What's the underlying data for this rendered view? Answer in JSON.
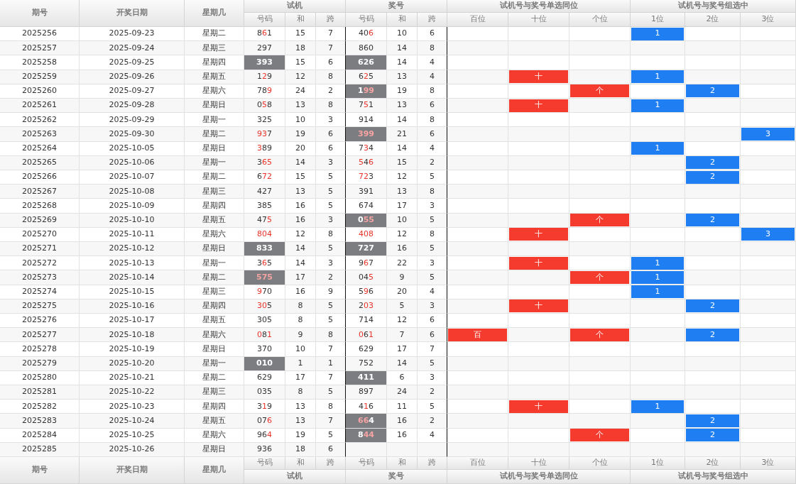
{
  "header": {
    "columns": [
      "期号",
      "开奖日期",
      "星期几"
    ],
    "groups": [
      {
        "label": "试机",
        "sub": [
          "号码",
          "和",
          "跨"
        ]
      },
      {
        "label": "奖号",
        "sub": [
          "号码",
          "和",
          "跨"
        ]
      },
      {
        "label": "试机号与奖号单选同位",
        "sub": [
          "百位",
          "十位",
          "个位"
        ]
      },
      {
        "label": "试机号与奖号组选中",
        "sub": [
          "1位",
          "2位",
          "3位"
        ]
      }
    ]
  },
  "rows": [
    {
      "issue": "2025256",
      "date": "2025-09-23",
      "weekday": "星期二",
      "trial": {
        "number": "861",
        "hits": [
          false,
          true,
          false
        ],
        "shaded": false
      },
      "trial_sum": "15",
      "trial_span": "7",
      "draw": {
        "number": "406",
        "hits": [
          false,
          false,
          true
        ],
        "shaded": false
      },
      "draw_sum": "10",
      "draw_span": "6",
      "single": {},
      "group": {
        "p1": "1"
      }
    },
    {
      "issue": "2025257",
      "date": "2025-09-24",
      "weekday": "星期三",
      "trial": {
        "number": "297",
        "hits": [
          false,
          false,
          false
        ],
        "shaded": false
      },
      "trial_sum": "18",
      "trial_span": "7",
      "draw": {
        "number": "860",
        "hits": [
          false,
          false,
          false
        ],
        "shaded": false
      },
      "draw_sum": "14",
      "draw_span": "8",
      "single": {},
      "group": {}
    },
    {
      "issue": "2025258",
      "date": "2025-09-25",
      "weekday": "星期四",
      "trial": {
        "number": "393",
        "hits": [
          false,
          false,
          false
        ],
        "shaded": true
      },
      "trial_sum": "15",
      "trial_span": "6",
      "draw": {
        "number": "626",
        "hits": [
          false,
          false,
          false
        ],
        "shaded": true
      },
      "draw_sum": "14",
      "draw_span": "4",
      "single": {},
      "group": {}
    },
    {
      "issue": "2025259",
      "date": "2025-09-26",
      "weekday": "星期五",
      "trial": {
        "number": "129",
        "hits": [
          false,
          true,
          false
        ],
        "shaded": false
      },
      "trial_sum": "12",
      "trial_span": "8",
      "draw": {
        "number": "625",
        "hits": [
          false,
          true,
          false
        ],
        "shaded": false
      },
      "draw_sum": "13",
      "draw_span": "4",
      "single": {
        "shi": "十"
      },
      "group": {
        "p1": "1"
      }
    },
    {
      "issue": "2025260",
      "date": "2025-09-27",
      "weekday": "星期六",
      "trial": {
        "number": "789",
        "hits": [
          false,
          false,
          true
        ],
        "shaded": false
      },
      "trial_sum": "24",
      "trial_span": "2",
      "draw": {
        "number": "199",
        "hits": [
          false,
          true,
          true
        ],
        "shaded": true
      },
      "draw_sum": "19",
      "draw_span": "8",
      "single": {
        "ge": "个"
      },
      "group": {
        "p2": "2"
      }
    },
    {
      "issue": "2025261",
      "date": "2025-09-28",
      "weekday": "星期日",
      "trial": {
        "number": "058",
        "hits": [
          false,
          true,
          false
        ],
        "shaded": false
      },
      "trial_sum": "13",
      "trial_span": "8",
      "draw": {
        "number": "751",
        "hits": [
          false,
          true,
          false
        ],
        "shaded": false
      },
      "draw_sum": "13",
      "draw_span": "6",
      "single": {
        "shi": "十"
      },
      "group": {
        "p1": "1"
      }
    },
    {
      "issue": "2025262",
      "date": "2025-09-29",
      "weekday": "星期一",
      "trial": {
        "number": "325",
        "hits": [
          false,
          false,
          false
        ],
        "shaded": false
      },
      "trial_sum": "10",
      "trial_span": "3",
      "draw": {
        "number": "914",
        "hits": [
          false,
          false,
          false
        ],
        "shaded": false
      },
      "draw_sum": "14",
      "draw_span": "8",
      "single": {},
      "group": {}
    },
    {
      "issue": "2025263",
      "date": "2025-09-30",
      "weekday": "星期二",
      "trial": {
        "number": "937",
        "hits": [
          true,
          true,
          false
        ],
        "shaded": false
      },
      "trial_sum": "19",
      "trial_span": "6",
      "draw": {
        "number": "399",
        "hits": [
          true,
          true,
          true
        ],
        "shaded": true
      },
      "draw_sum": "21",
      "draw_span": "6",
      "single": {},
      "group": {
        "p3": "3"
      }
    },
    {
      "issue": "2025264",
      "date": "2025-10-05",
      "weekday": "星期日",
      "trial": {
        "number": "389",
        "hits": [
          true,
          false,
          false
        ],
        "shaded": false
      },
      "trial_sum": "20",
      "trial_span": "6",
      "draw": {
        "number": "734",
        "hits": [
          false,
          true,
          false
        ],
        "shaded": false
      },
      "draw_sum": "14",
      "draw_span": "4",
      "single": {},
      "group": {
        "p1": "1"
      }
    },
    {
      "issue": "2025265",
      "date": "2025-10-06",
      "weekday": "星期一",
      "trial": {
        "number": "365",
        "hits": [
          false,
          true,
          true
        ],
        "shaded": false
      },
      "trial_sum": "14",
      "trial_span": "3",
      "draw": {
        "number": "546",
        "hits": [
          true,
          false,
          true
        ],
        "shaded": false
      },
      "draw_sum": "15",
      "draw_span": "2",
      "single": {},
      "group": {
        "p2": "2"
      }
    },
    {
      "issue": "2025266",
      "date": "2025-10-07",
      "weekday": "星期二",
      "trial": {
        "number": "672",
        "hits": [
          false,
          true,
          true
        ],
        "shaded": false
      },
      "trial_sum": "15",
      "trial_span": "5",
      "draw": {
        "number": "723",
        "hits": [
          true,
          true,
          false
        ],
        "shaded": false
      },
      "draw_sum": "12",
      "draw_span": "5",
      "single": {},
      "group": {
        "p2": "2"
      }
    },
    {
      "issue": "2025267",
      "date": "2025-10-08",
      "weekday": "星期三",
      "trial": {
        "number": "427",
        "hits": [
          false,
          false,
          false
        ],
        "shaded": false
      },
      "trial_sum": "13",
      "trial_span": "5",
      "draw": {
        "number": "391",
        "hits": [
          false,
          false,
          false
        ],
        "shaded": false
      },
      "draw_sum": "13",
      "draw_span": "8",
      "single": {},
      "group": {}
    },
    {
      "issue": "2025268",
      "date": "2025-10-09",
      "weekday": "星期四",
      "trial": {
        "number": "385",
        "hits": [
          false,
          false,
          false
        ],
        "shaded": false
      },
      "trial_sum": "16",
      "trial_span": "5",
      "draw": {
        "number": "674",
        "hits": [
          false,
          false,
          false
        ],
        "shaded": false
      },
      "draw_sum": "17",
      "draw_span": "3",
      "single": {},
      "group": {}
    },
    {
      "issue": "2025269",
      "date": "2025-10-10",
      "weekday": "星期五",
      "trial": {
        "number": "475",
        "hits": [
          false,
          false,
          true
        ],
        "shaded": false
      },
      "trial_sum": "16",
      "trial_span": "3",
      "draw": {
        "number": "055",
        "hits": [
          false,
          true,
          true
        ],
        "shaded": true
      },
      "draw_sum": "10",
      "draw_span": "5",
      "single": {
        "ge": "个"
      },
      "group": {
        "p2": "2"
      }
    },
    {
      "issue": "2025270",
      "date": "2025-10-11",
      "weekday": "星期六",
      "trial": {
        "number": "804",
        "hits": [
          true,
          true,
          true
        ],
        "shaded": false
      },
      "trial_sum": "12",
      "trial_span": "8",
      "draw": {
        "number": "408",
        "hits": [
          true,
          true,
          true
        ],
        "shaded": false
      },
      "draw_sum": "12",
      "draw_span": "8",
      "single": {
        "shi": "十"
      },
      "group": {
        "p3": "3"
      }
    },
    {
      "issue": "2025271",
      "date": "2025-10-12",
      "weekday": "星期日",
      "trial": {
        "number": "833",
        "hits": [
          false,
          false,
          false
        ],
        "shaded": true
      },
      "trial_sum": "14",
      "trial_span": "5",
      "draw": {
        "number": "727",
        "hits": [
          false,
          false,
          false
        ],
        "shaded": true
      },
      "draw_sum": "16",
      "draw_span": "5",
      "single": {},
      "group": {}
    },
    {
      "issue": "2025272",
      "date": "2025-10-13",
      "weekday": "星期一",
      "trial": {
        "number": "365",
        "hits": [
          false,
          true,
          false
        ],
        "shaded": false
      },
      "trial_sum": "14",
      "trial_span": "3",
      "draw": {
        "number": "967",
        "hits": [
          false,
          true,
          false
        ],
        "shaded": false
      },
      "draw_sum": "22",
      "draw_span": "3",
      "single": {
        "shi": "十"
      },
      "group": {
        "p1": "1"
      }
    },
    {
      "issue": "2025273",
      "date": "2025-10-14",
      "weekday": "星期二",
      "trial": {
        "number": "575",
        "hits": [
          true,
          true,
          true
        ],
        "shaded": true
      },
      "trial_sum": "17",
      "trial_span": "2",
      "draw": {
        "number": "045",
        "hits": [
          false,
          false,
          true
        ],
        "shaded": false
      },
      "draw_sum": "9",
      "draw_span": "5",
      "single": {
        "ge": "个"
      },
      "group": {
        "p1": "1"
      }
    },
    {
      "issue": "2025274",
      "date": "2025-10-15",
      "weekday": "星期三",
      "trial": {
        "number": "970",
        "hits": [
          true,
          false,
          false
        ],
        "shaded": false
      },
      "trial_sum": "16",
      "trial_span": "9",
      "draw": {
        "number": "596",
        "hits": [
          false,
          true,
          false
        ],
        "shaded": false
      },
      "draw_sum": "20",
      "draw_span": "4",
      "single": {},
      "group": {
        "p1": "1"
      }
    },
    {
      "issue": "2025275",
      "date": "2025-10-16",
      "weekday": "星期四",
      "trial": {
        "number": "305",
        "hits": [
          true,
          true,
          false
        ],
        "shaded": false
      },
      "trial_sum": "8",
      "trial_span": "5",
      "draw": {
        "number": "203",
        "hits": [
          false,
          true,
          true
        ],
        "shaded": false
      },
      "draw_sum": "5",
      "draw_span": "3",
      "single": {
        "shi": "十"
      },
      "group": {
        "p2": "2"
      }
    },
    {
      "issue": "2025276",
      "date": "2025-10-17",
      "weekday": "星期五",
      "trial": {
        "number": "305",
        "hits": [
          false,
          false,
          false
        ],
        "shaded": false
      },
      "trial_sum": "8",
      "trial_span": "5",
      "draw": {
        "number": "714",
        "hits": [
          false,
          false,
          false
        ],
        "shaded": false
      },
      "draw_sum": "12",
      "draw_span": "6",
      "single": {},
      "group": {}
    },
    {
      "issue": "2025277",
      "date": "2025-10-18",
      "weekday": "星期六",
      "trial": {
        "number": "081",
        "hits": [
          true,
          false,
          true
        ],
        "shaded": false
      },
      "trial_sum": "9",
      "trial_span": "8",
      "draw": {
        "number": "061",
        "hits": [
          true,
          false,
          true
        ],
        "shaded": false
      },
      "draw_sum": "7",
      "draw_span": "6",
      "single": {
        "bai": "百",
        "ge": "个"
      },
      "group": {
        "p2": "2"
      }
    },
    {
      "issue": "2025278",
      "date": "2025-10-19",
      "weekday": "星期日",
      "trial": {
        "number": "370",
        "hits": [
          false,
          false,
          false
        ],
        "shaded": false
      },
      "trial_sum": "10",
      "trial_span": "7",
      "draw": {
        "number": "629",
        "hits": [
          false,
          false,
          false
        ],
        "shaded": false
      },
      "draw_sum": "17",
      "draw_span": "7",
      "single": {},
      "group": {}
    },
    {
      "issue": "2025279",
      "date": "2025-10-20",
      "weekday": "星期一",
      "trial": {
        "number": "010",
        "hits": [
          false,
          false,
          false
        ],
        "shaded": true
      },
      "trial_sum": "1",
      "trial_span": "1",
      "draw": {
        "number": "752",
        "hits": [
          false,
          false,
          false
        ],
        "shaded": false
      },
      "draw_sum": "14",
      "draw_span": "5",
      "single": {},
      "group": {}
    },
    {
      "issue": "2025280",
      "date": "2025-10-21",
      "weekday": "星期二",
      "trial": {
        "number": "629",
        "hits": [
          false,
          false,
          false
        ],
        "shaded": false
      },
      "trial_sum": "17",
      "trial_span": "7",
      "draw": {
        "number": "411",
        "hits": [
          false,
          false,
          false
        ],
        "shaded": true
      },
      "draw_sum": "6",
      "draw_span": "3",
      "single": {},
      "group": {}
    },
    {
      "issue": "2025281",
      "date": "2025-10-22",
      "weekday": "星期三",
      "trial": {
        "number": "035",
        "hits": [
          false,
          false,
          false
        ],
        "shaded": false
      },
      "trial_sum": "8",
      "trial_span": "5",
      "draw": {
        "number": "897",
        "hits": [
          false,
          false,
          false
        ],
        "shaded": false
      },
      "draw_sum": "24",
      "draw_span": "2",
      "single": {},
      "group": {}
    },
    {
      "issue": "2025282",
      "date": "2025-10-23",
      "weekday": "星期四",
      "trial": {
        "number": "319",
        "hits": [
          false,
          true,
          false
        ],
        "shaded": false
      },
      "trial_sum": "13",
      "trial_span": "8",
      "draw": {
        "number": "416",
        "hits": [
          false,
          true,
          false
        ],
        "shaded": false
      },
      "draw_sum": "11",
      "draw_span": "5",
      "single": {
        "shi": "十"
      },
      "group": {
        "p1": "1"
      }
    },
    {
      "issue": "2025283",
      "date": "2025-10-24",
      "weekday": "星期五",
      "trial": {
        "number": "076",
        "hits": [
          false,
          false,
          true
        ],
        "shaded": false
      },
      "trial_sum": "13",
      "trial_span": "7",
      "draw": {
        "number": "664",
        "hits": [
          true,
          true,
          false
        ],
        "shaded": true
      },
      "draw_sum": "16",
      "draw_span": "2",
      "single": {},
      "group": {
        "p2": "2"
      }
    },
    {
      "issue": "2025284",
      "date": "2025-10-25",
      "weekday": "星期六",
      "trial": {
        "number": "964",
        "hits": [
          false,
          false,
          true
        ],
        "shaded": false
      },
      "trial_sum": "19",
      "trial_span": "5",
      "draw": {
        "number": "844",
        "hits": [
          false,
          true,
          true
        ],
        "shaded": true
      },
      "draw_sum": "16",
      "draw_span": "4",
      "single": {
        "ge": "个"
      },
      "group": {
        "p2": "2"
      }
    },
    {
      "issue": "2025285",
      "date": "2025-10-26",
      "weekday": "星期日",
      "trial": {
        "number": "936",
        "hits": [
          false,
          false,
          false
        ],
        "shaded": false
      },
      "trial_sum": "18",
      "trial_span": "6",
      "single": {},
      "group": {}
    }
  ],
  "footer": {
    "columns": [
      "期号",
      "开奖日期",
      "星期几"
    ],
    "groups": [
      {
        "label": "试机",
        "sub": [
          "号码",
          "和",
          "跨"
        ]
      },
      {
        "label": "奖号",
        "sub": [
          "号码",
          "和",
          "跨"
        ]
      },
      {
        "label": "试机号与奖号单选同位",
        "sub": [
          "百位",
          "十位",
          "个位"
        ]
      },
      {
        "label": "试机号与奖号组选中",
        "sub": [
          "1位",
          "2位",
          "3位"
        ]
      }
    ]
  }
}
